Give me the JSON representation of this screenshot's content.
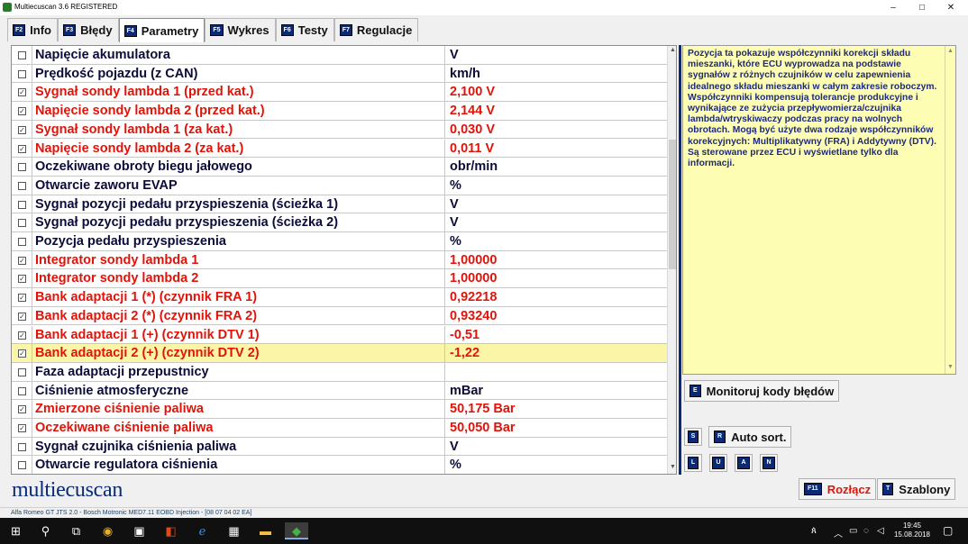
{
  "window": {
    "title": "Multiecuscan 3.6 REGISTERED",
    "min_glyph": "–",
    "max_glyph": "□",
    "close_glyph": "✕"
  },
  "tabs": [
    {
      "key": "F2",
      "label": "Info"
    },
    {
      "key": "F3",
      "label": "Błędy"
    },
    {
      "key": "F4",
      "label": "Parametry"
    },
    {
      "key": "F5",
      "label": "Wykres"
    },
    {
      "key": "F6",
      "label": "Testy"
    },
    {
      "key": "F7",
      "label": "Regulacje"
    }
  ],
  "active_tab": "Parametry",
  "parameters": [
    {
      "name": "Napięcie akumulatora",
      "value": "V",
      "checked": false
    },
    {
      "name": "Prędkość pojazdu (z CAN)",
      "value": "km/h",
      "checked": false
    },
    {
      "name": "Sygnał sondy lambda 1 (przed kat.)",
      "value": "2,100 V",
      "checked": true
    },
    {
      "name": "Napięcie sondy lambda 2 (przed kat.)",
      "value": "2,144 V",
      "checked": true
    },
    {
      "name": "Sygnał sondy lambda 1 (za kat.)",
      "value": "0,030 V",
      "checked": true
    },
    {
      "name": "Napięcie sondy lambda 2 (za kat.)",
      "value": "0,011 V",
      "checked": true
    },
    {
      "name": "Oczekiwane obroty biegu jałowego",
      "value": "obr/min",
      "checked": false
    },
    {
      "name": "Otwarcie zaworu EVAP",
      "value": "%",
      "checked": false
    },
    {
      "name": "Sygnał pozycji pedału przyspieszenia (ścieżka 1)",
      "value": "V",
      "checked": false
    },
    {
      "name": "Sygnał pozycji pedału przyspieszenia (ścieżka 2)",
      "value": "V",
      "checked": false
    },
    {
      "name": "Pozycja pedału przyspieszenia",
      "value": "%",
      "checked": false
    },
    {
      "name": "Integrator sondy lambda 1",
      "value": "1,00000",
      "checked": true
    },
    {
      "name": "Integrator sondy lambda 2",
      "value": "1,00000",
      "checked": true
    },
    {
      "name": "Bank adaptacji 1 (*) (czynnik FRA 1)",
      "value": "0,92218",
      "checked": true
    },
    {
      "name": "Bank adaptacji 2 (*) (czynnik FRA 2)",
      "value": "0,93240",
      "checked": true
    },
    {
      "name": "Bank adaptacji 1 (+) (czynnik DTV 1)",
      "value": "-0,51",
      "checked": true
    },
    {
      "name": "Bank adaptacji 2 (+) (czynnik DTV 2)",
      "value": "-1,22",
      "checked": true,
      "selected": true
    },
    {
      "name": "Faza adaptacji przepustnicy",
      "value": "",
      "checked": false
    },
    {
      "name": "Ciśnienie atmosferyczne",
      "value": "mBar",
      "checked": false
    },
    {
      "name": "Zmierzone ciśnienie paliwa",
      "value": "50,175 Bar",
      "checked": true
    },
    {
      "name": "Oczekiwane ciśnienie paliwa",
      "value": "50,050 Bar",
      "checked": true
    },
    {
      "name": "Sygnał czujnika ciśnienia paliwa",
      "value": "V",
      "checked": false
    },
    {
      "name": "Otwarcie regulatora ciśnienia",
      "value": "%",
      "checked": false
    }
  ],
  "description": "Pozycja ta pokazuje współczynniki korekcji składu mieszanki, które ECU wyprowadza na podstawie sygnałów z różnych czujników w celu zapewnienia idealnego składu mieszanki w całym zakresie roboczym. Współczynniki kompensują tolerancje produkcyjne i wynikające ze zużycia przepływomierza/czujnika lambda/wtryskiwaczy podczas pracy na wolnych obrotach. Mogą być użyte dwa rodzaje współczynników korekcyjnych: Multiplikatywny (FRA) i Addytywny (DTV). Są sterowane przez ECU i wyświetlane tylko dla informacji.",
  "buttons": {
    "monitor": {
      "key": "E",
      "label": "Monitoruj kody błędów"
    },
    "s": {
      "key": "S"
    },
    "auto_sort": {
      "key": "R",
      "label": "Auto sort."
    },
    "l": {
      "key": "L"
    },
    "u": {
      "key": "U"
    },
    "a": {
      "key": "A"
    },
    "n": {
      "key": "N"
    },
    "disconnect": {
      "key": "F11",
      "label": "Rozłącz"
    },
    "templates": {
      "key": "T",
      "label": "Szablony"
    }
  },
  "logo": "multiecuscan",
  "status": "Alfa Romeo GT JTS 2.0 - Bosch Motronic MED7.11 EOBD Injection - [08 07 04 02 EA]",
  "clock": {
    "time": "19:45",
    "date": "15.08.2018"
  },
  "taskbar_icons": [
    "windows-start-icon",
    "search-icon",
    "task-view-icon",
    "chrome-icon",
    "store-icon",
    "office-icon",
    "edge-icon",
    "calculator-icon",
    "file-explorer-icon",
    "multiecuscan-icon"
  ],
  "colors": {
    "active_value": "#e1140a",
    "inactive_text": "#0c0c3a",
    "selected_row": "#fbf5a8",
    "accent": "#0a2a78",
    "description_bg": "#fefdb4"
  }
}
